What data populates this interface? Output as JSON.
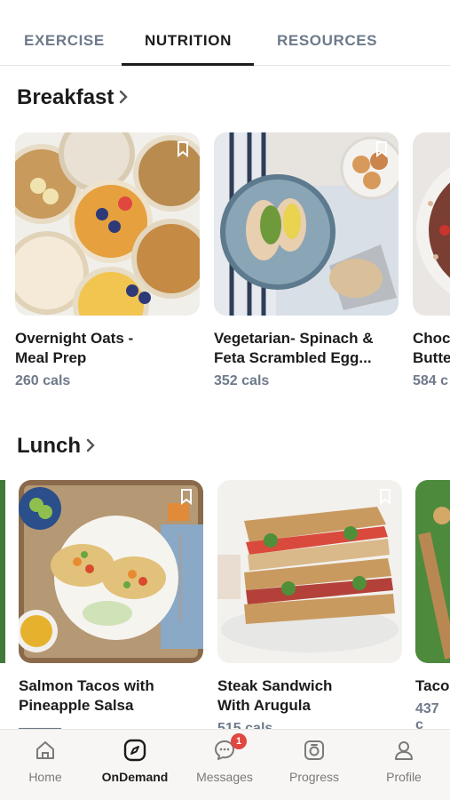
{
  "tabs": [
    {
      "label": "EXERCISE"
    },
    {
      "label": "NUTRITION"
    },
    {
      "label": "RESOURCES"
    }
  ],
  "sections": {
    "breakfast": {
      "title": "Breakfast",
      "cards": [
        {
          "title": "Overnight Oats -\nMeal Prep",
          "cals": "260 cals"
        },
        {
          "title": "Vegetarian- Spinach &\nFeta Scrambled Egg...",
          "cals": "352 cals"
        },
        {
          "title": "Choc\nButte",
          "cals": "584 c"
        }
      ]
    },
    "lunch": {
      "title": "Lunch",
      "cards": [
        {
          "title": "Salmon Tacos with\nPineapple Salsa",
          "cals": "———"
        },
        {
          "title": "Steak Sandwich\nWith Arugula",
          "cals": "515 cals"
        },
        {
          "title": "Taco",
          "cals": "437 c"
        }
      ]
    }
  },
  "nav": {
    "items": [
      {
        "label": "Home",
        "icon": "home-icon"
      },
      {
        "label": "OnDemand",
        "icon": "compass-icon"
      },
      {
        "label": "Messages",
        "icon": "chat-icon",
        "badge": "1"
      },
      {
        "label": "Progress",
        "icon": "scale-icon"
      },
      {
        "label": "Profile",
        "icon": "person-icon"
      }
    ],
    "active": "OnDemand"
  },
  "colors": {
    "accent": "#1c1c1c",
    "muted": "#6e7a8a",
    "badge": "#e0473f"
  }
}
